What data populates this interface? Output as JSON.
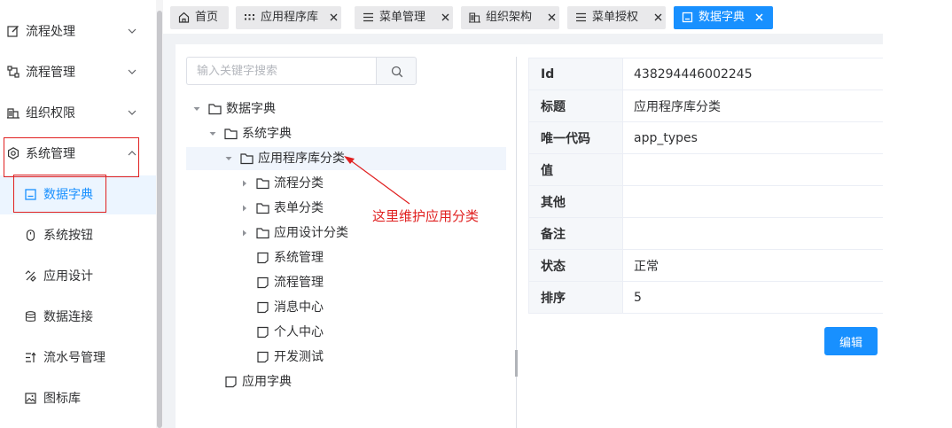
{
  "sidebar": {
    "menus": [
      {
        "label": "流程处理",
        "icon": "edit-icon"
      },
      {
        "label": "流程管理",
        "icon": "flow-icon"
      },
      {
        "label": "组织权限",
        "icon": "org-icon"
      },
      {
        "label": "系统管理",
        "icon": "gear-icon"
      }
    ],
    "submenus": [
      {
        "label": "数据字典",
        "icon": "book-icon"
      },
      {
        "label": "系统按钮",
        "icon": "mouse-icon"
      },
      {
        "label": "应用设计",
        "icon": "design-icon"
      },
      {
        "label": "数据连接",
        "icon": "database-icon"
      },
      {
        "label": "流水号管理",
        "icon": "sort-icon"
      },
      {
        "label": "图标库",
        "icon": "image-icon"
      }
    ]
  },
  "tabs": [
    {
      "label": "首页",
      "icon": "home-icon",
      "active": false
    },
    {
      "label": "应用程序库",
      "icon": "grid-icon",
      "active": false
    },
    {
      "label": "菜单管理",
      "icon": "menu-icon",
      "active": false
    },
    {
      "label": "组织架构",
      "icon": "org-icon",
      "active": false
    },
    {
      "label": "菜单授权",
      "icon": "menu-icon",
      "active": false
    },
    {
      "label": "数据字典",
      "icon": "book-icon",
      "active": true
    }
  ],
  "search": {
    "placeholder": "输入关键字搜索"
  },
  "tree": [
    {
      "label": "数据字典",
      "level": 0,
      "expanded": true,
      "folder": true
    },
    {
      "label": "系统字典",
      "level": 1,
      "expanded": true,
      "folder": true
    },
    {
      "label": "应用程序库分类",
      "level": 2,
      "expanded": true,
      "folder": true,
      "selected": true
    },
    {
      "label": "流程分类",
      "level": 3,
      "expanded": false,
      "folder": true
    },
    {
      "label": "表单分类",
      "level": 3,
      "expanded": false,
      "folder": true
    },
    {
      "label": "应用设计分类",
      "level": 3,
      "expanded": false,
      "folder": true
    },
    {
      "label": "系统管理",
      "level": 3,
      "folder": false
    },
    {
      "label": "流程管理",
      "level": 3,
      "folder": false
    },
    {
      "label": "消息中心",
      "level": 3,
      "folder": false
    },
    {
      "label": "个人中心",
      "level": 3,
      "folder": false
    },
    {
      "label": "开发测试",
      "level": 3,
      "folder": false
    },
    {
      "label": "应用字典",
      "level": 1,
      "folder": false
    }
  ],
  "annotation": {
    "text": "这里维护应用分类",
    "color": "#e02020"
  },
  "detail": {
    "rows": [
      {
        "label": "Id",
        "value": "438294446002245"
      },
      {
        "label": "标题",
        "value": "应用程序库分类"
      },
      {
        "label": "唯一代码",
        "value": "app_types"
      },
      {
        "label": "值",
        "value": ""
      },
      {
        "label": "其他",
        "value": ""
      },
      {
        "label": "备注",
        "value": ""
      },
      {
        "label": "状态",
        "value": "正常"
      },
      {
        "label": "排序",
        "value": "5"
      }
    ],
    "edit_label": "编辑"
  },
  "colors": {
    "primary": "#1890ff",
    "highlight": "#e02020"
  }
}
